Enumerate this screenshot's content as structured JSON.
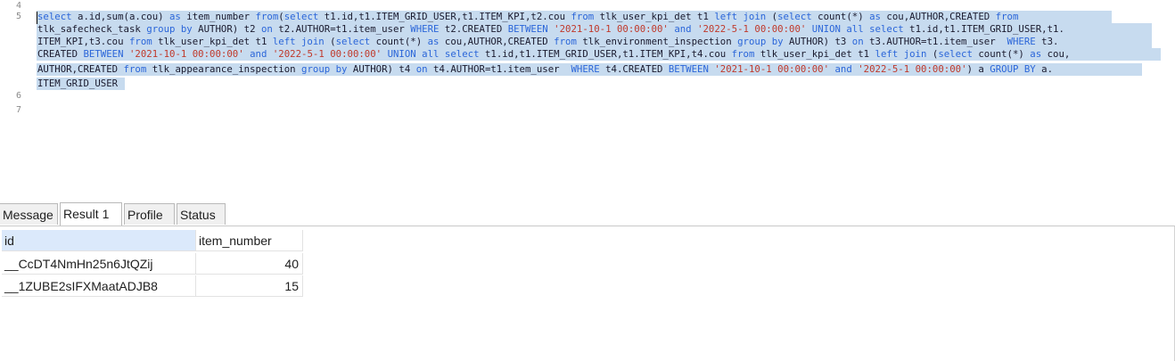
{
  "editor": {
    "line_numbers": [
      "4",
      "5",
      "6",
      "7"
    ],
    "sql_lines": [
      [
        [
          "kw",
          "select"
        ],
        [
          "t",
          " a.id,sum(a.cou) "
        ],
        [
          "kw",
          "as"
        ],
        [
          "t",
          " item_number "
        ],
        [
          "kw",
          "from"
        ],
        [
          "t",
          "("
        ],
        [
          "kw",
          "select"
        ],
        [
          "t",
          " t1.id,t1.ITEM_GRID_USER,t1.ITEM_KPI,t2.cou "
        ],
        [
          "kw",
          "from"
        ],
        [
          "t",
          " tlk_user_kpi_det t1 "
        ],
        [
          "kw",
          "left join"
        ],
        [
          "t",
          " ("
        ],
        [
          "kw",
          "select"
        ],
        [
          "t",
          " count(*) "
        ],
        [
          "kw",
          "as"
        ],
        [
          "t",
          " cou,AUTHOR,CREATED "
        ],
        [
          "kw",
          "from"
        ]
      ],
      [
        [
          "t",
          "tlk_safecheck_task "
        ],
        [
          "kw",
          "group by"
        ],
        [
          "t",
          " AUTHOR) t2 "
        ],
        [
          "kw",
          "on"
        ],
        [
          "t",
          " t2.AUTHOR=t1.item_user "
        ],
        [
          "kw",
          "WHERE"
        ],
        [
          "t",
          " t2.CREATED "
        ],
        [
          "kw",
          "BETWEEN"
        ],
        [
          "t",
          " "
        ],
        [
          "str",
          "'2021-10-1 00:00:00'"
        ],
        [
          "t",
          " "
        ],
        [
          "kw",
          "and"
        ],
        [
          "t",
          " "
        ],
        [
          "str",
          "'2022-5-1 00:00:00'"
        ],
        [
          "t",
          " "
        ],
        [
          "kw",
          "UNION all select"
        ],
        [
          "t",
          " t1.id,t1.ITEM_GRID_USER,t1."
        ]
      ],
      [
        [
          "t",
          "ITEM_KPI,t3.cou "
        ],
        [
          "kw",
          "from"
        ],
        [
          "t",
          " tlk_user_kpi_det t1 "
        ],
        [
          "kw",
          "left join"
        ],
        [
          "t",
          " ("
        ],
        [
          "kw",
          "select"
        ],
        [
          "t",
          " count(*) "
        ],
        [
          "kw",
          "as"
        ],
        [
          "t",
          " cou,AUTHOR,CREATED "
        ],
        [
          "kw",
          "from"
        ],
        [
          "t",
          " tlk_environment_inspection "
        ],
        [
          "kw",
          "group by"
        ],
        [
          "t",
          " AUTHOR) t3 "
        ],
        [
          "kw",
          "on"
        ],
        [
          "t",
          " t3.AUTHOR=t1.item_user  "
        ],
        [
          "kw",
          "WHERE"
        ],
        [
          "t",
          " t3."
        ]
      ],
      [
        [
          "t",
          "CREATED "
        ],
        [
          "kw",
          "BETWEEN"
        ],
        [
          "t",
          " "
        ],
        [
          "str",
          "'2021-10-1 00:00:00'"
        ],
        [
          "t",
          " "
        ],
        [
          "kw",
          "and"
        ],
        [
          "t",
          " "
        ],
        [
          "str",
          "'2022-5-1 00:00:00'"
        ],
        [
          "t",
          " "
        ],
        [
          "kw",
          "UNION all select"
        ],
        [
          "t",
          " t1.id,t1.ITEM_GRID_USER,t1.ITEM_KPI,t4.cou "
        ],
        [
          "kw",
          "from"
        ],
        [
          "t",
          " tlk_user_kpi_det t1 "
        ],
        [
          "kw",
          "left join"
        ],
        [
          "t",
          " ("
        ],
        [
          "kw",
          "select"
        ],
        [
          "t",
          " count(*) "
        ],
        [
          "kw",
          "as"
        ],
        [
          "t",
          " cou,"
        ]
      ],
      [
        [
          "t",
          "AUTHOR,CREATED "
        ],
        [
          "kw",
          "from"
        ],
        [
          "t",
          " tlk_appearance_inspection "
        ],
        [
          "kw",
          "group by"
        ],
        [
          "t",
          " AUTHOR) t4 "
        ],
        [
          "kw",
          "on"
        ],
        [
          "t",
          " t4.AUTHOR=t1.item_user  "
        ],
        [
          "kw",
          "WHERE"
        ],
        [
          "t",
          " t4.CREATED "
        ],
        [
          "kw",
          "BETWEEN"
        ],
        [
          "t",
          " "
        ],
        [
          "str",
          "'2021-10-1 00:00:00'"
        ],
        [
          "t",
          " "
        ],
        [
          "kw",
          "and"
        ],
        [
          "t",
          " "
        ],
        [
          "str",
          "'2022-5-1 00:00:00'"
        ],
        [
          "t",
          ") a "
        ],
        [
          "kw",
          "GROUP BY"
        ],
        [
          "t",
          " a."
        ]
      ],
      [
        [
          "t",
          "ITEM_GRID_USER"
        ]
      ]
    ],
    "colors": {
      "keyword": "#2b66d9",
      "string": "#c0392b",
      "selection": "#c7dbef"
    }
  },
  "tabs": [
    {
      "label": "Message",
      "active": false
    },
    {
      "label": "Result 1",
      "active": true
    },
    {
      "label": "Profile",
      "active": false
    },
    {
      "label": "Status",
      "active": false
    }
  ],
  "result": {
    "columns": [
      "id",
      "item_number"
    ],
    "rows": [
      [
        "__CcDT4NmHn25n6JtQZij",
        "40"
      ],
      [
        "__1ZUBE2sIFXMaatADJB8",
        "15"
      ]
    ]
  }
}
